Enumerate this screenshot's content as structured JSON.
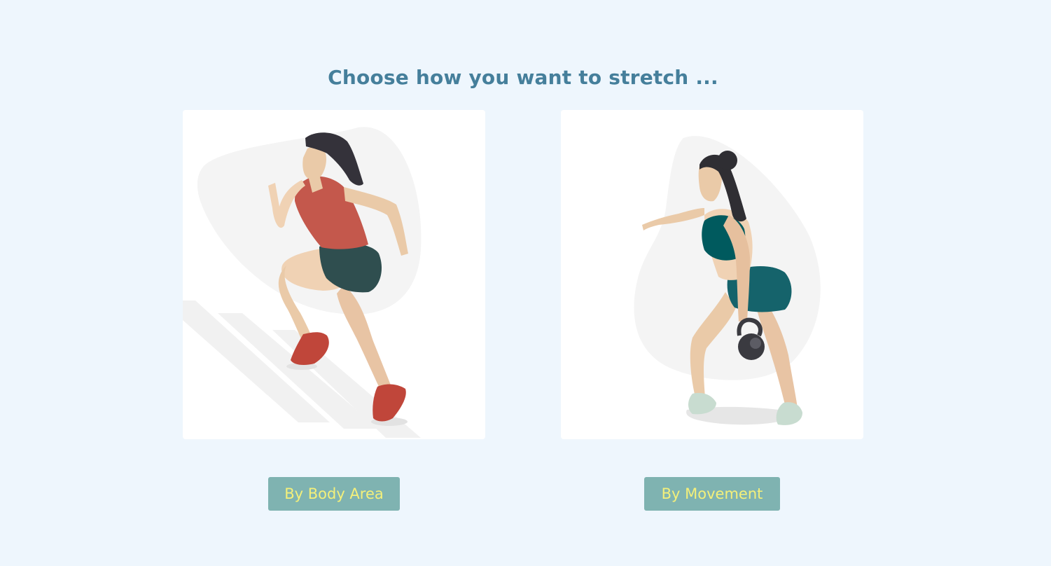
{
  "page": {
    "title": "Choose how you want to stretch ..."
  },
  "options": [
    {
      "illustration": "woman-running-stairs-illustration",
      "button_label": "By Body Area"
    },
    {
      "illustration": "woman-kettlebell-swing-illustration",
      "button_label": "By Movement"
    }
  ],
  "colors": {
    "background": "#eef6fd",
    "title": "#457f9b",
    "button_bg": "#7fb3b1",
    "button_text": "#f4f07a"
  }
}
